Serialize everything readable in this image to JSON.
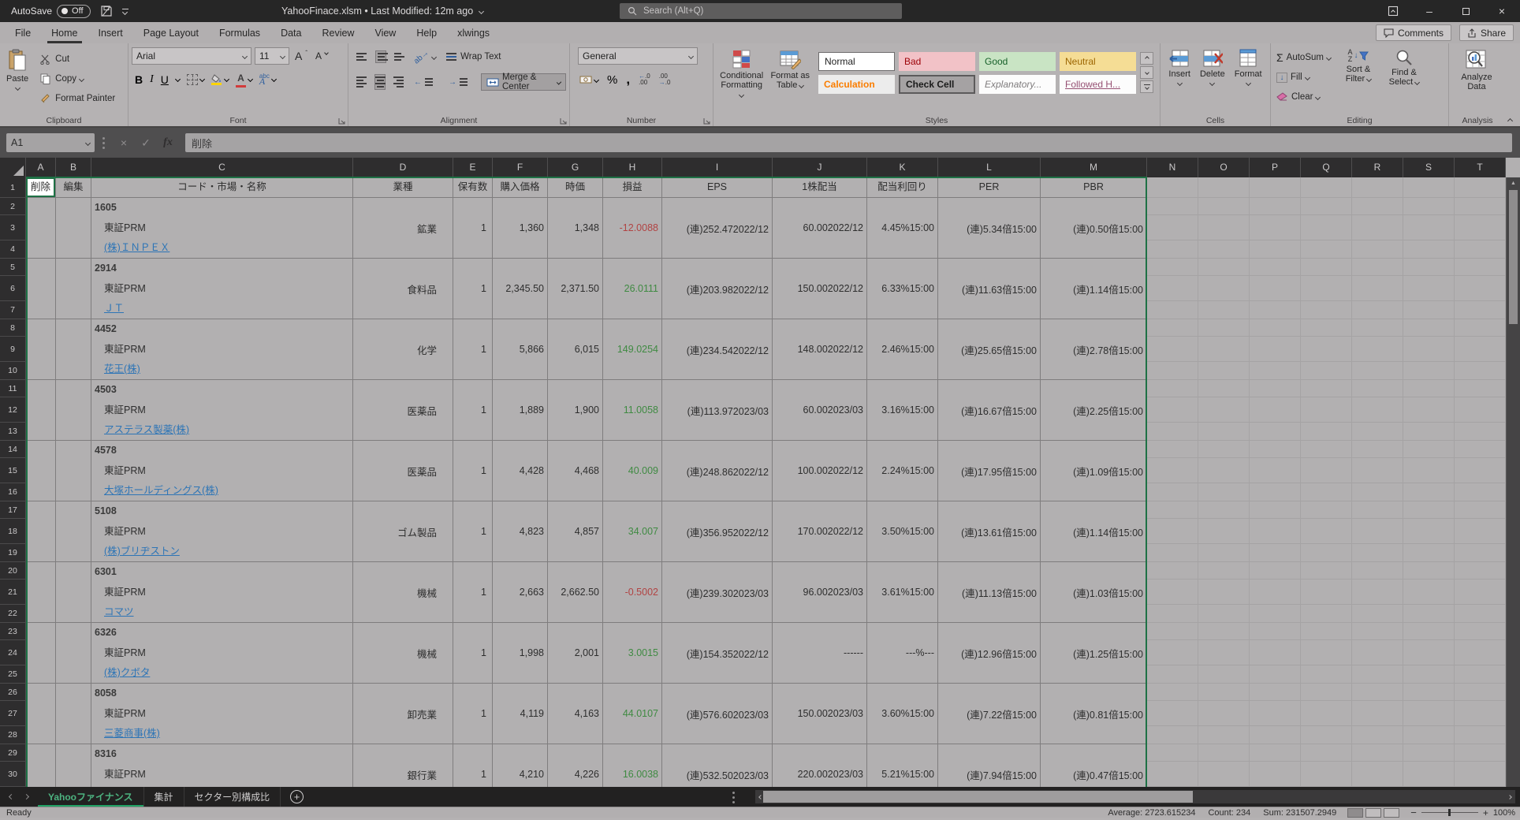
{
  "title_bar": {
    "autosave_label": "AutoSave",
    "autosave_state": "Off",
    "title": "YahooFinace.xlsm • Last Modified: 12m ago",
    "search_placeholder": "Search (Alt+Q)"
  },
  "ribbon_tabs": [
    {
      "label": "File"
    },
    {
      "label": "Home",
      "active": true
    },
    {
      "label": "Insert"
    },
    {
      "label": "Page Layout"
    },
    {
      "label": "Formulas"
    },
    {
      "label": "Data"
    },
    {
      "label": "Review"
    },
    {
      "label": "View"
    },
    {
      "label": "Help"
    },
    {
      "label": "xlwings"
    }
  ],
  "top_right": {
    "comments": "Comments",
    "share": "Share"
  },
  "ribbon": {
    "clipboard": {
      "group": "Clipboard",
      "paste": "Paste",
      "cut": "Cut",
      "copy": "Copy",
      "format_painter": "Format Painter"
    },
    "font": {
      "group": "Font",
      "font_name": "Arial",
      "font_size": "11"
    },
    "alignment": {
      "group": "Alignment",
      "wrap_text": "Wrap Text",
      "merge_center": "Merge & Center"
    },
    "number": {
      "group": "Number",
      "format": "General"
    },
    "styles": {
      "group": "Styles",
      "conditional_1": "Conditional",
      "conditional_2": "Formatting",
      "format_table_1": "Format as",
      "format_table_2": "Table",
      "gallery": [
        "Normal",
        "Bad",
        "Good",
        "Neutral",
        "Calculation",
        "Check Cell",
        "Explanatory...",
        "Followed H..."
      ]
    },
    "cells": {
      "group": "Cells",
      "insert": "Insert",
      "del": "Delete",
      "format": "Format"
    },
    "editing": {
      "group": "Editing",
      "autosum": "AutoSum",
      "fill": "Fill",
      "clear": "Clear",
      "sort_1": "Sort &",
      "sort_2": "Filter",
      "find_1": "Find &",
      "find_2": "Select"
    },
    "analysis": {
      "group": "Analysis",
      "analyze_1": "Analyze",
      "analyze_2": "Data"
    }
  },
  "formula_bar": {
    "name_box": "A1",
    "formula": "削除"
  },
  "grid": {
    "column_letters": [
      "A",
      "B",
      "C",
      "D",
      "E",
      "F",
      "G",
      "H",
      "I",
      "J",
      "K",
      "L",
      "M",
      "N",
      "O",
      "P",
      "Q",
      "R",
      "S",
      "T"
    ],
    "header_row": [
      "削除",
      "編集",
      "コード・市場・名称",
      "業種",
      "保有数",
      "購入価格",
      "時価",
      "損益",
      "EPS",
      "1株配当",
      "配当利回り",
      "PER",
      "PBR"
    ],
    "stocks": [
      {
        "code": "1605",
        "market": "東証PRM",
        "name": "(株)ＩＮＰＥＸ",
        "sector": "鉱業",
        "qty": "1",
        "buy": "1,360",
        "price": "1,348",
        "pl": "-12.0088",
        "pl_sign": "neg",
        "eps": "(連)252.472022/12",
        "div": "60.002022/12",
        "yield": "4.45%15:00",
        "per": "(連)5.34倍15:00",
        "pbr": "(連)0.50倍15:00"
      },
      {
        "code": "2914",
        "market": "東証PRM",
        "name": "ＪＴ",
        "sector": "食料品",
        "qty": "1",
        "buy": "2,345.50",
        "price": "2,371.50",
        "pl": "26.0111",
        "pl_sign": "pos",
        "eps": "(連)203.982022/12",
        "div": "150.002022/12",
        "yield": "6.33%15:00",
        "per": "(連)11.63倍15:00",
        "pbr": "(連)1.14倍15:00"
      },
      {
        "code": "4452",
        "market": "東証PRM",
        "name": "花王(株)",
        "sector": "化学",
        "qty": "1",
        "buy": "5,866",
        "price": "6,015",
        "pl": "149.0254",
        "pl_sign": "pos",
        "eps": "(連)234.542022/12",
        "div": "148.002022/12",
        "yield": "2.46%15:00",
        "per": "(連)25.65倍15:00",
        "pbr": "(連)2.78倍15:00"
      },
      {
        "code": "4503",
        "market": "東証PRM",
        "name": "アステラス製薬(株)",
        "sector": "医薬品",
        "qty": "1",
        "buy": "1,889",
        "price": "1,900",
        "pl": "11.0058",
        "pl_sign": "pos",
        "eps": "(連)113.972023/03",
        "div": "60.002023/03",
        "yield": "3.16%15:00",
        "per": "(連)16.67倍15:00",
        "pbr": "(連)2.25倍15:00"
      },
      {
        "code": "4578",
        "market": "東証PRM",
        "name": "大塚ホールディングス(株)",
        "sector": "医薬品",
        "qty": "1",
        "buy": "4,428",
        "price": "4,468",
        "pl": "40.009",
        "pl_sign": "pos",
        "eps": "(連)248.862022/12",
        "div": "100.002022/12",
        "yield": "2.24%15:00",
        "per": "(連)17.95倍15:00",
        "pbr": "(連)1.09倍15:00"
      },
      {
        "code": "5108",
        "market": "東証PRM",
        "name": "(株)ブリヂストン",
        "sector": "ゴム製品",
        "qty": "1",
        "buy": "4,823",
        "price": "4,857",
        "pl": "34.007",
        "pl_sign": "pos",
        "eps": "(連)356.952022/12",
        "div": "170.002022/12",
        "yield": "3.50%15:00",
        "per": "(連)13.61倍15:00",
        "pbr": "(連)1.14倍15:00"
      },
      {
        "code": "6301",
        "market": "東証PRM",
        "name": "コマツ",
        "sector": "機械",
        "qty": "1",
        "buy": "2,663",
        "price": "2,662.50",
        "pl": "-0.5002",
        "pl_sign": "neg",
        "eps": "(連)239.302023/03",
        "div": "96.002023/03",
        "yield": "3.61%15:00",
        "per": "(連)11.13倍15:00",
        "pbr": "(連)1.03倍15:00"
      },
      {
        "code": "6326",
        "market": "東証PRM",
        "name": "(株)クボタ",
        "sector": "機械",
        "qty": "1",
        "buy": "1,998",
        "price": "2,001",
        "pl": "3.0015",
        "pl_sign": "pos",
        "eps": "(連)154.352022/12",
        "div": "------",
        "yield": "---%---",
        "per": "(連)12.96倍15:00",
        "pbr": "(連)1.25倍15:00"
      },
      {
        "code": "8058",
        "market": "東証PRM",
        "name": "三菱商事(株)",
        "sector": "卸売業",
        "qty": "1",
        "buy": "4,119",
        "price": "4,163",
        "pl": "44.0107",
        "pl_sign": "pos",
        "eps": "(連)576.602023/03",
        "div": "150.002023/03",
        "yield": "3.60%15:00",
        "per": "(連)7.22倍15:00",
        "pbr": "(連)0.81倍15:00"
      },
      {
        "code": "8316",
        "market": "東証PRM",
        "name": "",
        "sector": "銀行業",
        "qty": "1",
        "buy": "4,210",
        "price": "4,226",
        "pl": "16.0038",
        "pl_sign": "pos",
        "eps": "(連)532.502023/03",
        "div": "220.002023/03",
        "yield": "5.21%15:00",
        "per": "(連)7.94倍15:00",
        "pbr": "(連)0.47倍15:00"
      }
    ]
  },
  "sheet_tabs": {
    "tabs": [
      {
        "label": "Yahooファイナンス",
        "active": true
      },
      {
        "label": "集計"
      },
      {
        "label": "セクター別構成比"
      }
    ]
  },
  "status_bar": {
    "ready": "Ready",
    "average": "Average: 2723.615234",
    "count": "Count: 234",
    "sum": "Sum: 231507.2949",
    "zoom": "100%"
  }
}
